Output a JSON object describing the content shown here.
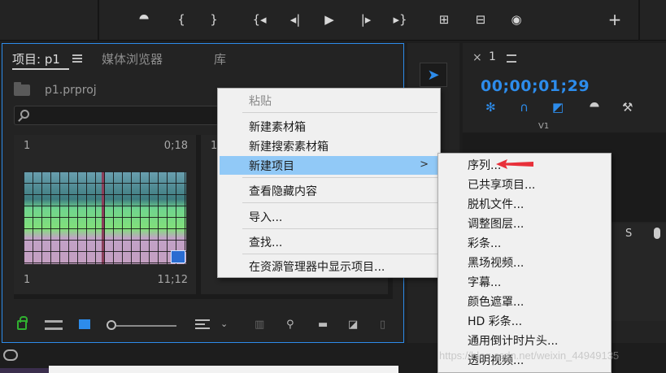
{
  "toolbar": {
    "buttons": [
      "marker-icon",
      "mark-in-icon",
      "mark-out-icon",
      "go-to-in-icon",
      "step-back-icon",
      "play-icon",
      "step-forward-icon",
      "go-to-out-icon",
      "insert-icon",
      "overwrite-icon",
      "export-frame-icon",
      "add-button-icon"
    ],
    "glyphs": {
      "marker": "⯊",
      "mark_in": "{",
      "mark_out": "}",
      "go_in": "{◂",
      "step_back": "◂|",
      "play": "▶",
      "step_fwd": "|▸",
      "go_out": "▸}",
      "insert": "⊞",
      "overwrite": "⊟",
      "camera": "◉",
      "plus": "+"
    }
  },
  "project_panel": {
    "tabs": [
      {
        "label": "项目: p1",
        "active": true
      },
      {
        "label": "媒体浏览器",
        "active": false
      },
      {
        "label": "库",
        "active": false
      }
    ],
    "bin_name": "p1.prproj",
    "search": {
      "placeholder": "",
      "value": ""
    },
    "cards": [
      {
        "index": "1",
        "duration": "0;18",
        "label_index": "1",
        "label_duration": "11;12"
      },
      {
        "index": "1",
        "duration": "",
        "label_index": "",
        "label_duration": ""
      }
    ]
  },
  "context_menu": {
    "items": [
      {
        "label": "粘贴",
        "disabled": true
      },
      {
        "label": "新建素材箱"
      },
      {
        "label": "新建搜索素材箱"
      },
      {
        "label": "新建项目",
        "highlight": true,
        "has_submenu": true,
        "arrow": ">"
      },
      {
        "label": "查看隐藏内容"
      },
      {
        "label": "导入..."
      },
      {
        "label": "查找..."
      },
      {
        "label": "在资源管理器中显示项目..."
      }
    ]
  },
  "submenu": {
    "items": [
      "序列...",
      "已共享项目...",
      "脱机文件...",
      "调整图层...",
      "彩条...",
      "黑场视频...",
      "字幕...",
      "颜色遮罩...",
      "HD 彩条...",
      "通用倒计时片头...",
      "透明视频..."
    ]
  },
  "timeline": {
    "close": "×",
    "sequence_name": "1",
    "timecode": "00;00;01;29",
    "track_label": "V1",
    "audio_solo": "S"
  },
  "watermark": "https://blog.csdn.net/weixin_44949135",
  "colors": {
    "accent": "#2d8ceb",
    "highlight": "#91c9f7",
    "arrow": "#e8303a"
  }
}
